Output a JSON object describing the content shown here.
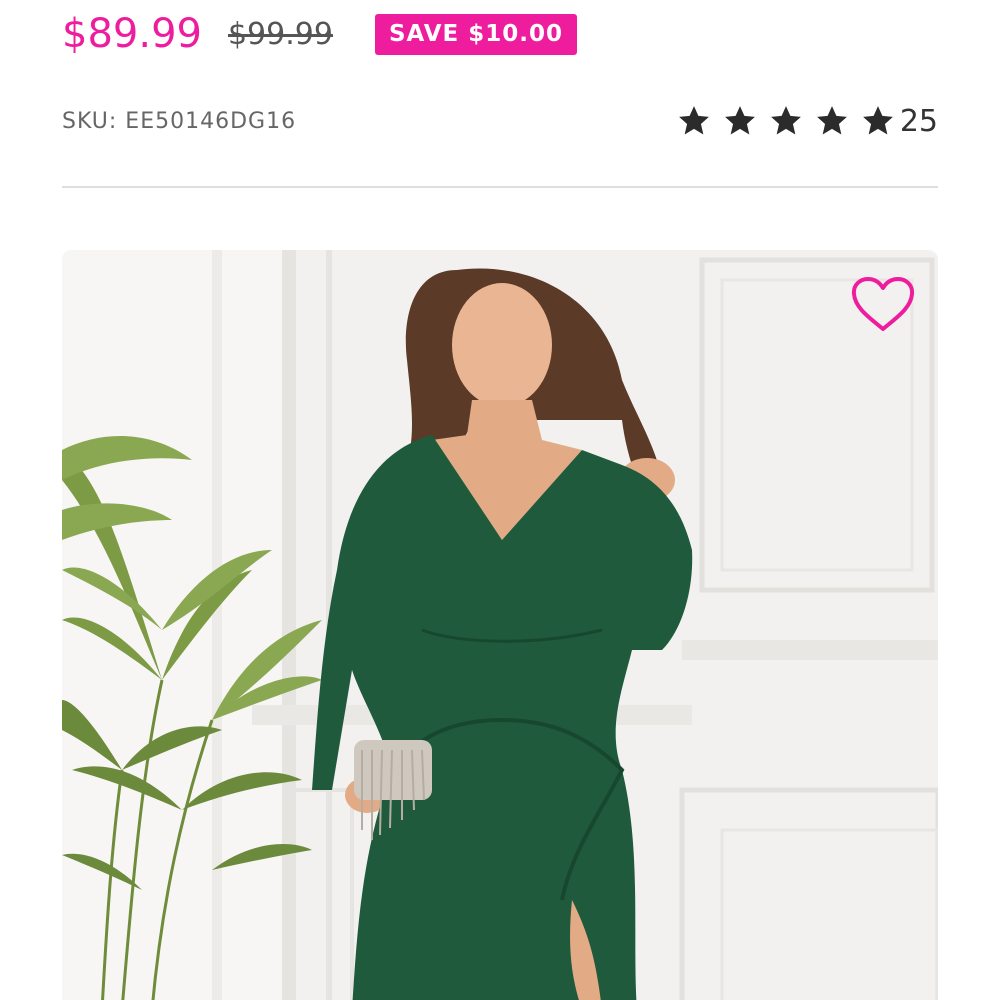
{
  "product": {
    "price_current": "$89.99",
    "price_original": "$99.99",
    "save_badge": "SAVE $10.00",
    "sku": "SKU: EE50146DG16",
    "rating": {
      "stars": 5,
      "max_stars": 5,
      "review_count": "25"
    }
  },
  "gallery": {
    "wishlist_icon": "heart-outline-icon",
    "image_subject": "product-photo"
  },
  "colors": {
    "accent": "#ee1d9e",
    "star": "#2b2b2b",
    "dress": "#1f5a3c"
  }
}
